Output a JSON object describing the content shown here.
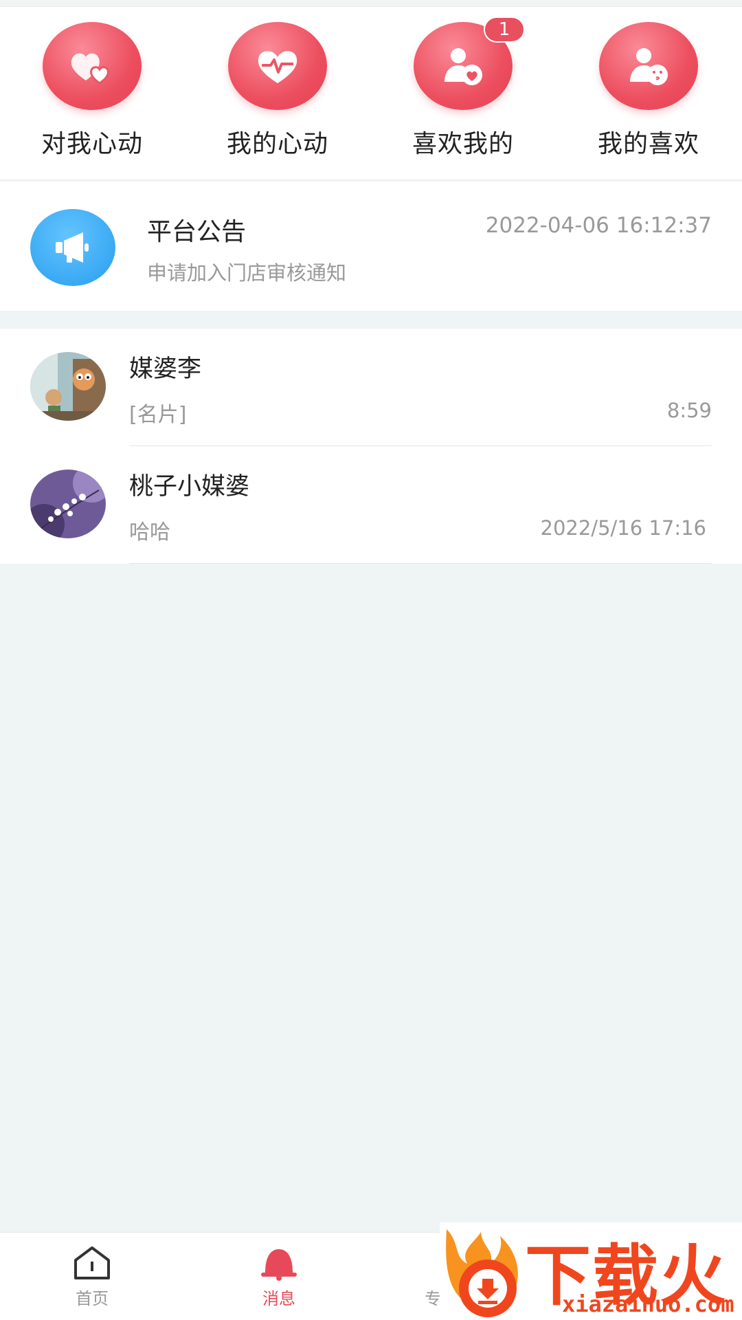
{
  "quick_actions": [
    {
      "label": "对我心动",
      "icon": "hearts-icon"
    },
    {
      "label": "我的心动",
      "icon": "heartbeat-icon"
    },
    {
      "label": "喜欢我的",
      "icon": "user-heart-icon",
      "badge": "1"
    },
    {
      "label": "我的喜欢",
      "icon": "user-kiss-icon"
    }
  ],
  "notice": {
    "title": "平台公告",
    "time": "2022-04-06 16:12:37",
    "subtitle": "申请加入门店审核通知",
    "icon": "megaphone-icon"
  },
  "chats": [
    {
      "name": "媒婆李",
      "preview": "[名片]",
      "time": "8:59"
    },
    {
      "name": "桃子小媒婆",
      "preview": "哈哈",
      "time": "2022/5/16 17:16"
    }
  ],
  "tabbar": {
    "home": "首页",
    "messages": "消息",
    "third": "专"
  },
  "watermark": {
    "title": "下载火",
    "url": "xiazaihuo.com"
  },
  "colors": {
    "accent": "#e64a5a",
    "notice_blue": "#3aa9f3",
    "background": "#eff4f4"
  }
}
